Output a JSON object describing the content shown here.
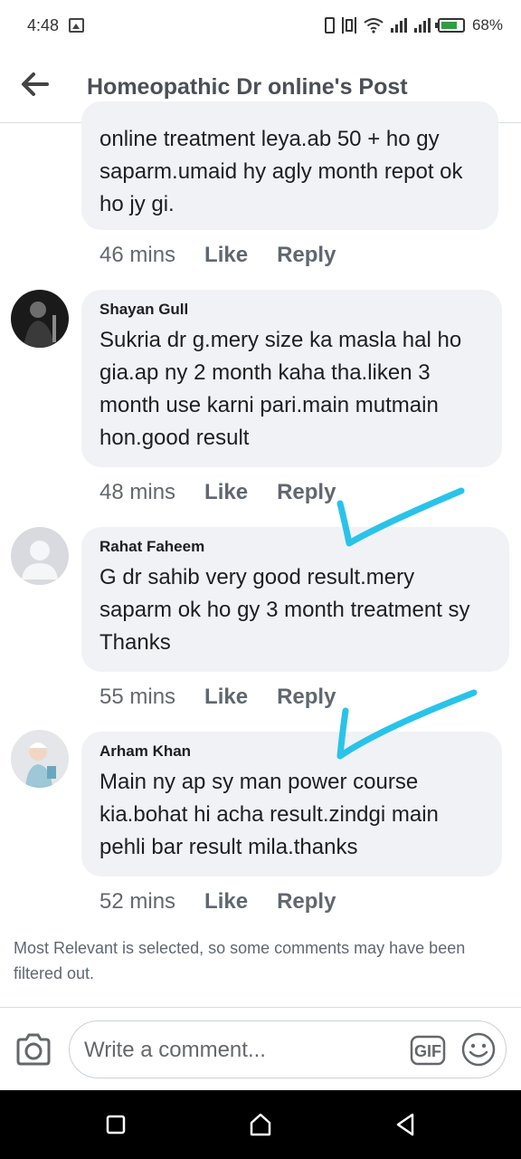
{
  "status_bar": {
    "time": "4:48",
    "battery": "68%"
  },
  "header": {
    "title": "Homeopathic Dr online's Post"
  },
  "comments": [
    {
      "author": "",
      "text": "online treatment leya.ab 50 + ho gy saparm.umaid hy agly month repot ok ho jy gi.",
      "time": "46 mins",
      "like": "Like",
      "reply": "Reply"
    },
    {
      "author": "Shayan Gull",
      "text": "Sukria dr g.mery size ka masla hal ho gia.ap ny 2 month kaha tha.liken 3 month use karni pari.main mutmain hon.good result",
      "time": "48 mins",
      "like": "Like",
      "reply": "Reply"
    },
    {
      "author": "Rahat Faheem",
      "text": "G dr sahib very good result.mery saparm ok ho gy 3 month treatment sy Thanks",
      "time": "55 mins",
      "like": "Like",
      "reply": "Reply"
    },
    {
      "author": "Arham Khan",
      "text": "Main ny ap sy man power course kia.bohat hi acha result.zindgi main pehli bar result mila.thanks",
      "time": "52 mins",
      "like": "Like",
      "reply": "Reply"
    }
  ],
  "notice": "Most Relevant is selected, so some comments may have been filtered out.",
  "composer": {
    "placeholder": "Write a comment...",
    "gif_label": "GIF"
  },
  "colors": {
    "annotation": "#29c3ea",
    "bubble": "#f0f2f5"
  }
}
